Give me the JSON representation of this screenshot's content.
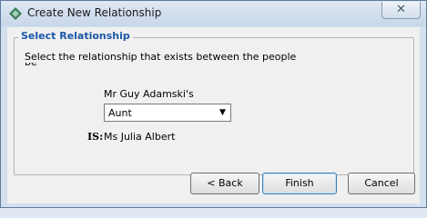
{
  "window": {
    "title": "Create New Relationship",
    "close_glyph": "✕"
  },
  "group": {
    "title": "Select Relationship",
    "instruction": "Select the relationship that exists between the people",
    "instruction_cut": "below"
  },
  "relationship": {
    "person1": "Mr Guy Adamski's",
    "selected": "Aunt",
    "is_label": "IS:",
    "person2": "Ms Julia Albert"
  },
  "buttons": {
    "back": "< Back",
    "finish": "Finish",
    "cancel": "Cancel"
  },
  "colors": {
    "group_title": "#1c56a8",
    "app_icon": "#3a7a5a"
  }
}
